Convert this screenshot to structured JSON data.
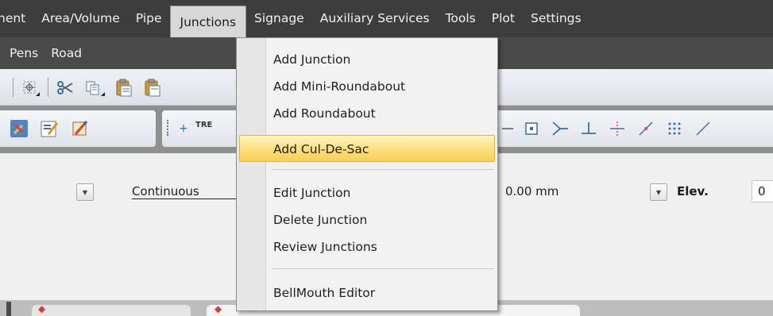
{
  "menubar": {
    "items": [
      "nent",
      "Area/Volume",
      "Pipe",
      "Junctions",
      "Signage",
      "Auxiliary Services",
      "Tools",
      "Plot",
      "Settings"
    ],
    "active": "Junctions"
  },
  "menubar2": {
    "items": [
      "Pens",
      "Road"
    ]
  },
  "toolbar2": {
    "track_label": "TRE"
  },
  "props": {
    "linetype": "Continuous",
    "thickness": "0.00 mm",
    "elev_label": "Elev.",
    "elev_value": "0"
  },
  "junctions_menu": {
    "items": [
      {
        "label": "Add Junction"
      },
      {
        "label": "Add Mini-Roundabout"
      },
      {
        "label": "Add Roundabout"
      },
      {
        "label": "Add Cul-De-Sac",
        "highlighted": true
      },
      {
        "label": "Edit Junction"
      },
      {
        "label": "Delete Junction"
      },
      {
        "label": "Review Junctions"
      },
      {
        "label": "BellMouth Editor"
      }
    ]
  },
  "colors": {
    "menubar_bg": "#3d3d3d",
    "highlight": "#fcdf7a",
    "toolbar_dark": "#8f8f8f"
  }
}
